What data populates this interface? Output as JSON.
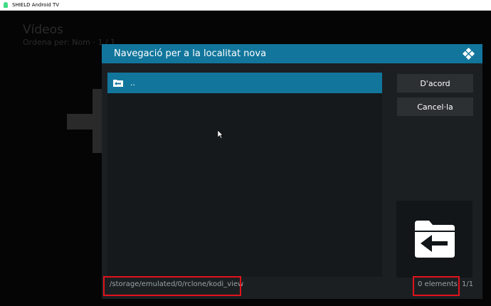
{
  "window": {
    "title": "SHIELD Android TV",
    "icon": "android-icon"
  },
  "background": {
    "title": "Vídeos",
    "sort_label": "Ordena per: Nom  ·  1 / 1"
  },
  "dialog": {
    "title": "Navegació per a la localitat nova",
    "logo_icon": "kodi-logo-icon",
    "list_items": [
      {
        "label": "..",
        "icon": "folder-back-icon"
      }
    ],
    "ok_label": "D'acord",
    "cancel_label": "Cancel·la",
    "thumbnail_icon": "folder-back-icon",
    "path": "/storage/emulated/0/rclone/kodi_view",
    "item_count": "0 elements",
    "page": "1/1"
  },
  "colors": {
    "accent": "#12769c",
    "dialog_bg": "#1b1f22",
    "highlight": "#e0131a"
  }
}
